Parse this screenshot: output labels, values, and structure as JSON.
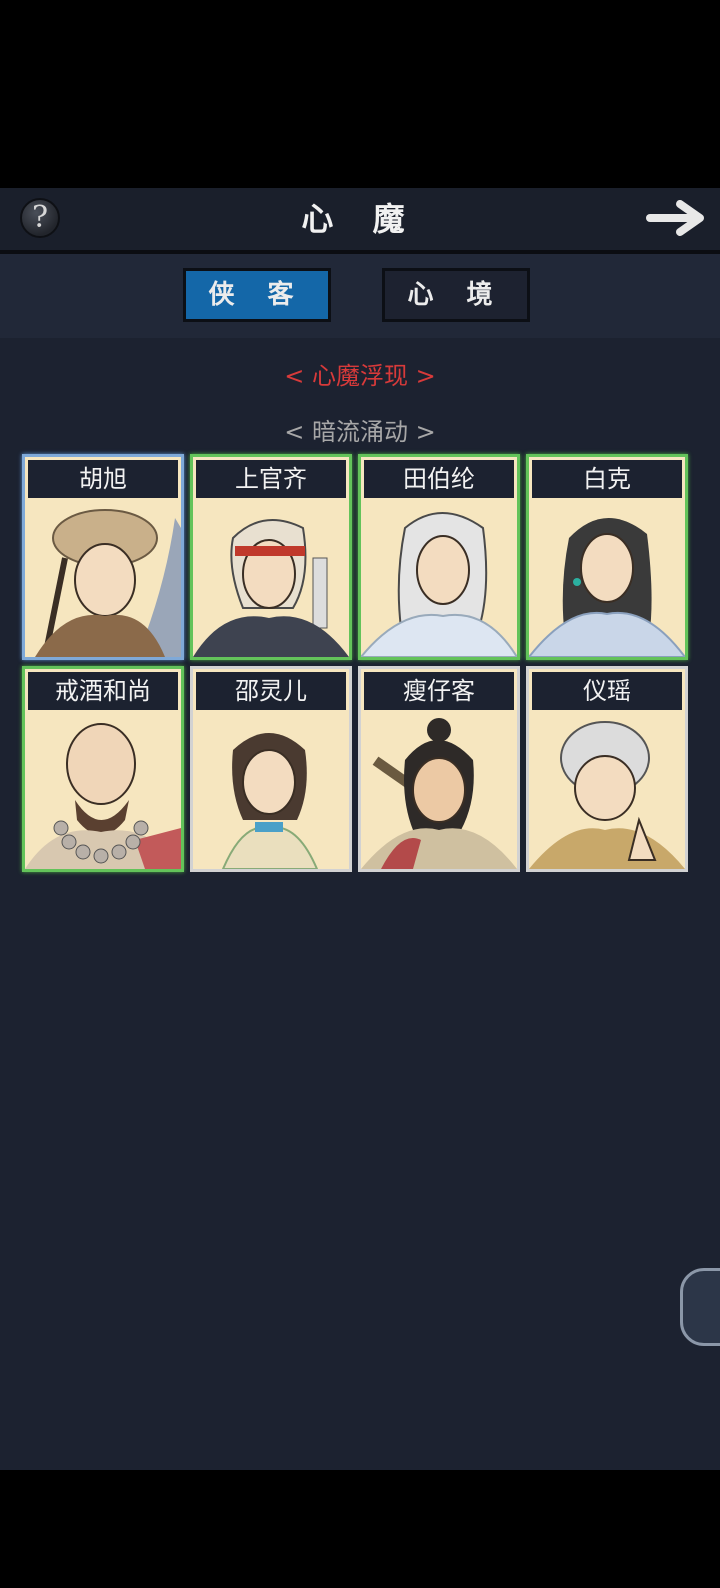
{
  "header": {
    "title": "心 魔",
    "help_label": "?"
  },
  "tabs": [
    {
      "label": "侠 客",
      "active": true
    },
    {
      "label": "心 境",
      "active": false
    }
  ],
  "sections": {
    "red_title": "< 心魔浮现 >",
    "gray_title": "< 暗流涌动 >"
  },
  "colors": {
    "accent_blue": "#1467a8",
    "red": "#d83a3a",
    "green_border": "#63c35a",
    "blue_border": "#7fa9d8"
  },
  "characters": [
    {
      "name": "胡旭",
      "rarity": "blue",
      "icon": "portrait-fur-hat"
    },
    {
      "name": "上官齐",
      "rarity": "green",
      "icon": "portrait-headband"
    },
    {
      "name": "田伯纶",
      "rarity": "green",
      "icon": "portrait-long-hair"
    },
    {
      "name": "白克",
      "rarity": "green",
      "icon": "portrait-earring"
    },
    {
      "name": "戒酒和尚",
      "rarity": "green",
      "icon": "portrait-monk"
    },
    {
      "name": "邵灵儿",
      "rarity": "white",
      "icon": "portrait-girl"
    },
    {
      "name": "瘦仔客",
      "rarity": "white",
      "icon": "portrait-warrior"
    },
    {
      "name": "仪瑶",
      "rarity": "white",
      "icon": "portrait-nun"
    }
  ]
}
